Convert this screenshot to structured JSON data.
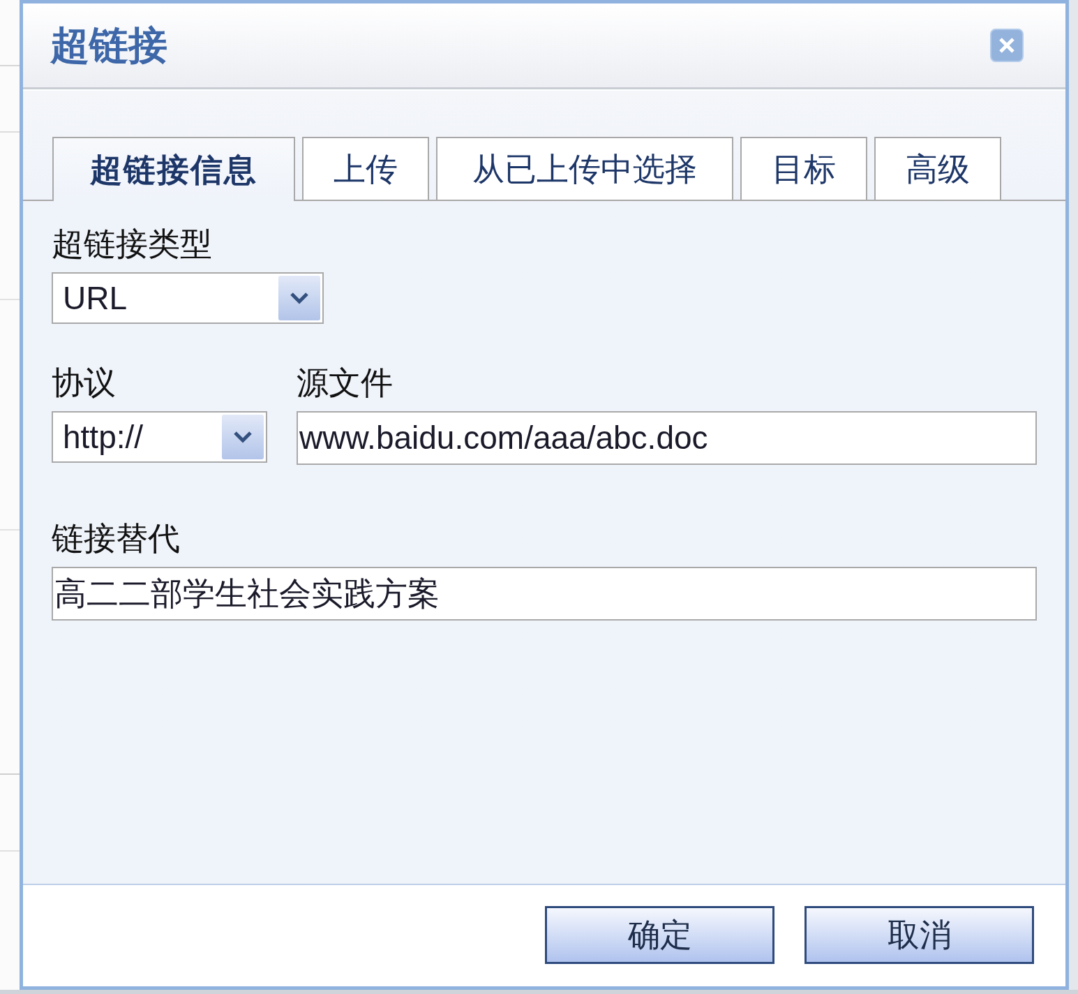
{
  "dialog": {
    "title": "超链接"
  },
  "tabs": [
    {
      "label": "超链接信息",
      "selected": true
    },
    {
      "label": "上传",
      "selected": false
    },
    {
      "label": "从已上传中选择",
      "selected": false
    },
    {
      "label": "目标",
      "selected": false
    },
    {
      "label": "高级",
      "selected": false
    }
  ],
  "rows": [
    {
      "fields": [
        {
          "label": "超链接类型",
          "kind": "select",
          "value": "URL"
        }
      ]
    },
    {
      "fields": [
        {
          "label": "协议",
          "kind": "select",
          "value": "http://"
        },
        {
          "label": "源文件",
          "kind": "text",
          "value": "www.baidu.com/aaa/abc.doc"
        }
      ]
    },
    {
      "fields": [
        {
          "label": "链接替代",
          "kind": "text",
          "value": "高二二部学生社会实践方案"
        }
      ]
    }
  ],
  "buttons": [
    "确定",
    "取消"
  ]
}
